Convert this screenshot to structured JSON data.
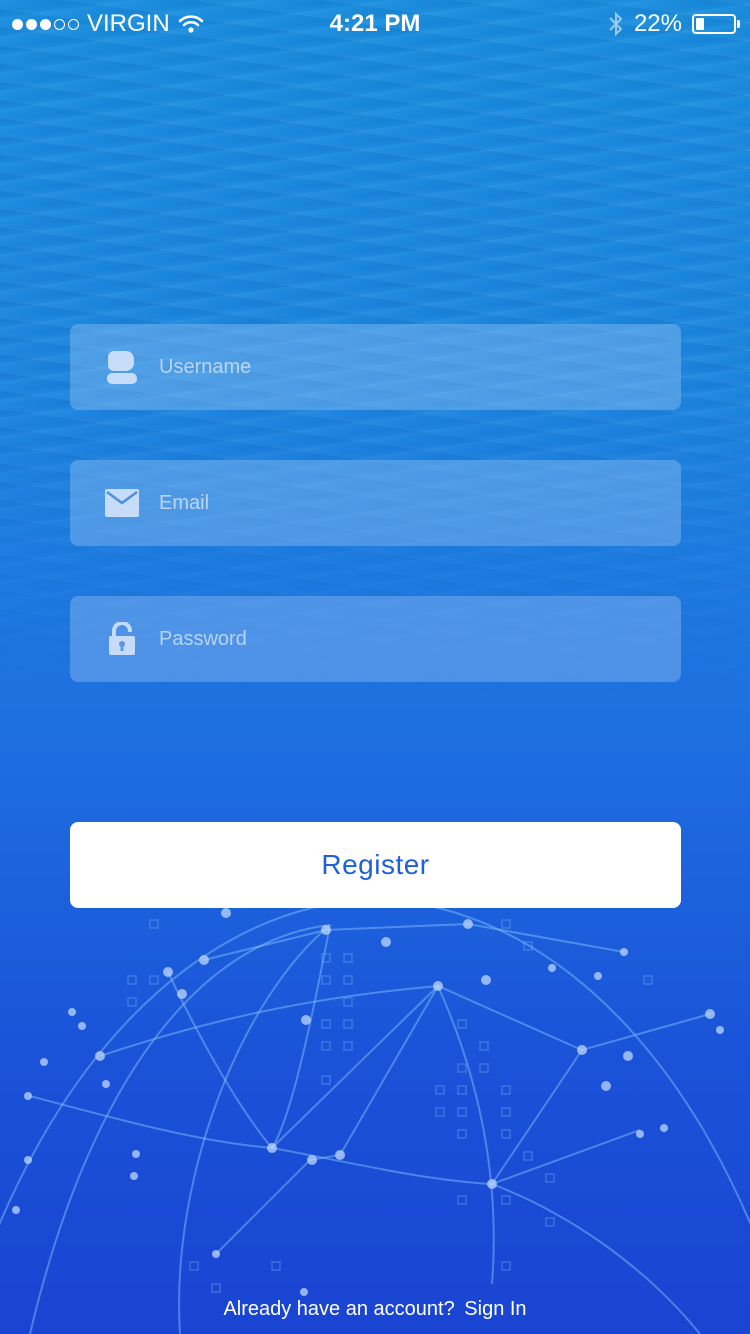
{
  "status_bar": {
    "carrier": "VIRGIN",
    "time": "4:21 PM",
    "battery_percent_text": "22%",
    "battery_level": 0.22,
    "signal_filled": 3,
    "signal_total": 5
  },
  "form": {
    "username": {
      "placeholder": "Username",
      "value": "",
      "icon": "user-icon"
    },
    "email": {
      "placeholder": "Email",
      "value": "",
      "icon": "mail-icon"
    },
    "password": {
      "placeholder": "Password",
      "value": "",
      "icon": "lock-icon"
    }
  },
  "register_label": "Register",
  "footer": {
    "prompt": "Already have an account?",
    "signin_label": "Sign In"
  },
  "colors": {
    "accent": "#1f62d6",
    "background_top": "#1a8ede",
    "background_bottom": "#1a44d2"
  }
}
